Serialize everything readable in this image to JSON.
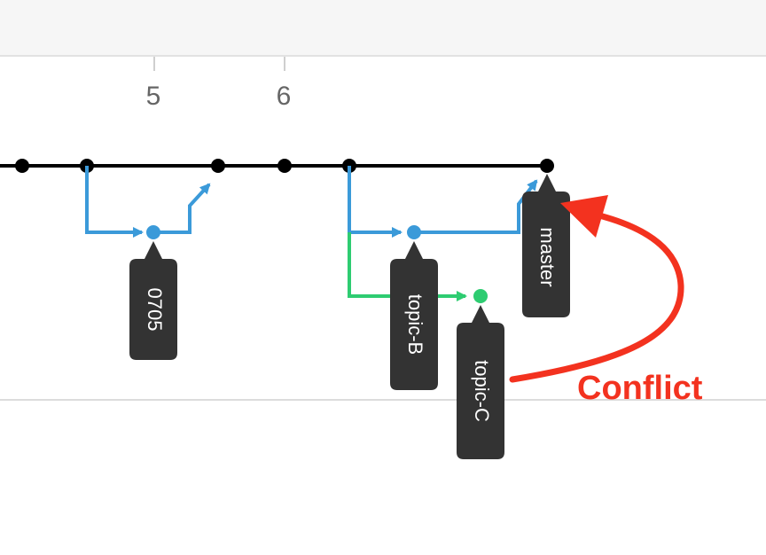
{
  "timeline_ticks": [
    "5",
    "6"
  ],
  "branches": {
    "main": {
      "label": "master",
      "color": "#000000"
    },
    "tag_0705": {
      "label": "0705",
      "color": "#3b9ad9"
    },
    "topic_b": {
      "label": "topic-B",
      "color": "#3b9ad9"
    },
    "topic_c": {
      "label": "topic-C",
      "color": "#2ecc71"
    }
  },
  "annotation": {
    "label": "Conflict",
    "color": "#f3321f"
  },
  "tag_color": "#333333"
}
